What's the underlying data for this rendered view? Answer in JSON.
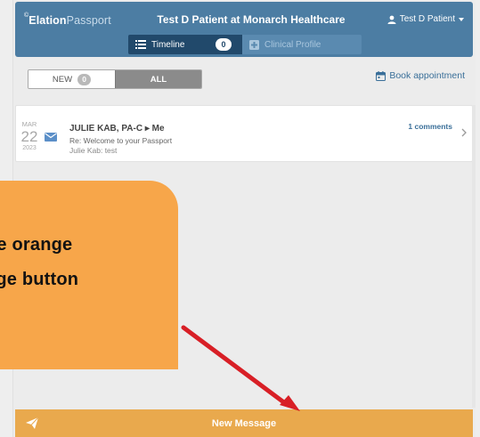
{
  "header": {
    "brand_part1": "Elation",
    "brand_part2": "Passport",
    "title": "Test D Patient at Monarch Healthcare",
    "user_name": "Test D Patient",
    "tabs": [
      {
        "label": "Timeline",
        "count": "0",
        "active": true
      },
      {
        "label": "Clinical Profile",
        "active": false
      }
    ]
  },
  "filters": {
    "new_label": "NEW",
    "new_count": "0",
    "all_label": "ALL"
  },
  "book_appointment_label": "Book appointment",
  "messages": [
    {
      "month": "MAR",
      "day": "22",
      "year": "2023",
      "sender": "JULIE KAB, PA-C ▸ Me",
      "subject": "Re: Welcome to your Passport",
      "preview": "Julie Kab: test",
      "comments": "1 comments"
    }
  ],
  "new_message_label": "New Message",
  "callout": {
    "line1": "he orange",
    "line2": "age button"
  },
  "colors": {
    "header_bg": "#4c7da3",
    "active_tab": "#21496b",
    "accent_orange": "#e9a94d",
    "callout_orange": "#f7a64a",
    "link_blue": "#3a6f99",
    "arrow_red": "#d81f26"
  },
  "icons": [
    "list-icon",
    "plus-square-icon",
    "user-icon",
    "caret-down-icon",
    "calendar-icon",
    "mail-icon",
    "chevron-right-icon",
    "send-icon"
  ]
}
